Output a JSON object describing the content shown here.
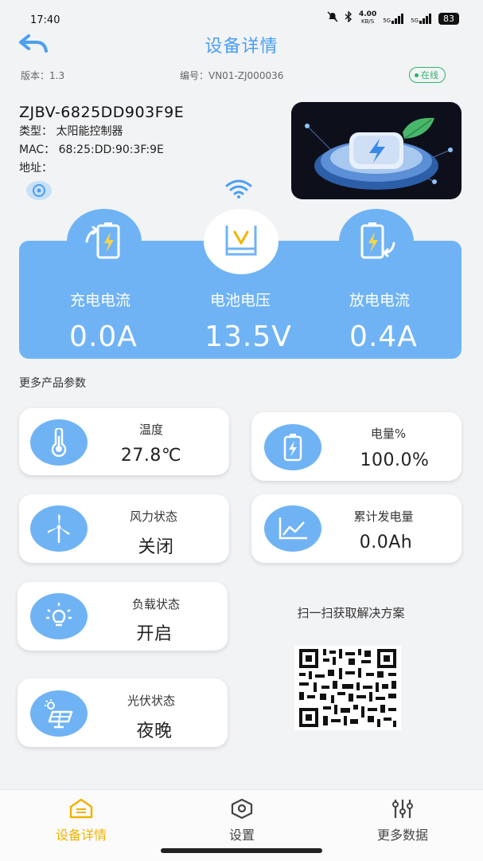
{
  "status_bar": {
    "time": "17:40",
    "speed_value": "4.00",
    "speed_unit": "KB/S",
    "network_1": "5G",
    "network_2": "5G",
    "battery": "83"
  },
  "header": {
    "title": "设备详情"
  },
  "meta": {
    "version": "版本：1.3",
    "serial": "编号：VN01-ZJ000036",
    "status": "在线"
  },
  "device": {
    "name": "ZJBV-6825DD903F9E",
    "type": "类型：  太阳能控制器",
    "mac": "MAC：  68:25:DD:90:3F:9E",
    "address": "地址："
  },
  "stats": [
    {
      "label": "充电电流",
      "value": "0.0A",
      "icon": "battery-charging-icon"
    },
    {
      "label": "电池电压",
      "value": "13.5V",
      "icon": "battery-voltage-icon"
    },
    {
      "label": "放电电流",
      "value": "0.4A",
      "icon": "battery-discharge-icon"
    }
  ],
  "params_title": "更多产品参数",
  "params": {
    "temperature": {
      "label": "温度",
      "value": "27.8℃",
      "icon": "thermometer-icon"
    },
    "charge": {
      "label": "电量%",
      "value": "100.0%",
      "icon": "battery-level-icon"
    },
    "wind": {
      "label": "风力状态",
      "value": "关闭",
      "icon": "wind-turbine-icon"
    },
    "generated": {
      "label": "累计发电量",
      "value": "0.0Ah",
      "icon": "line-chart-icon"
    },
    "load": {
      "label": "负载状态",
      "value": "开启",
      "icon": "light-bulb-icon"
    },
    "pv": {
      "label": "光伏状态",
      "value": "夜晚",
      "icon": "solar-panel-icon"
    }
  },
  "qr": {
    "caption": "扫一扫获取解决方案"
  },
  "nav": {
    "items": [
      {
        "label": "设备详情",
        "active": true,
        "icon": "device-home-icon"
      },
      {
        "label": "设置",
        "active": false,
        "icon": "settings-box-icon"
      },
      {
        "label": "更多数据",
        "active": false,
        "icon": "sliders-icon"
      }
    ]
  },
  "colors": {
    "accent_blue": "#6fb3f5",
    "title_blue": "#4a9ff2",
    "online_green": "#2fb36b",
    "active_yellow": "#f2b300"
  }
}
